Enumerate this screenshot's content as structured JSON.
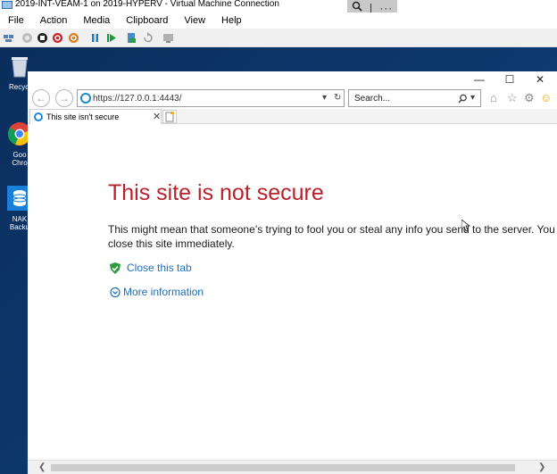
{
  "vm_window": {
    "title": "2019-INT-VEAM-1 on 2019-HYPERV - Virtual Machine Connection",
    "menu": [
      "File",
      "Action",
      "Media",
      "Clipboard",
      "View",
      "Help"
    ],
    "zoom_icon": "zoom-icon",
    "more_icon": "ellipsis-icon"
  },
  "desktop": {
    "icons": [
      {
        "label": "Recycl",
        "icon": "recycle-bin-icon"
      },
      {
        "label_lines": [
          "Goo",
          "Chro"
        ],
        "icon": "chrome-icon"
      },
      {
        "label_lines": [
          "NAK",
          "Backu"
        ],
        "icon": "database-icon"
      }
    ]
  },
  "browser": {
    "address": "https://127.0.0.1:4443/",
    "search_placeholder": "Search...",
    "tab": {
      "title": "This site isn't secure"
    },
    "colors": {
      "heading": "#b9212b",
      "link": "#1d6fb8",
      "shield": "#2e9c3b"
    }
  },
  "page": {
    "heading": "This site is not secure",
    "warning_line_1": "This might mean that someone’s trying to fool you or steal any info you send to the server. You shou",
    "warning_line_2": "close this site immediately.",
    "close_tab_link": "Close this tab",
    "more_info_link": "More information"
  }
}
